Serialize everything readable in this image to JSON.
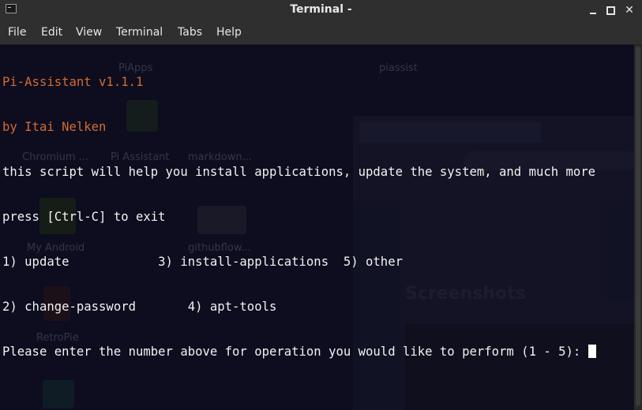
{
  "window": {
    "title": "Terminal -",
    "icon": "terminal-icon",
    "controls": [
      "minimize-icon",
      "maximize-icon",
      "close-icon"
    ],
    "close_glyph": "✕"
  },
  "menubar": {
    "items": [
      "File",
      "Edit",
      "View",
      "Terminal",
      "Tabs",
      "Help"
    ]
  },
  "terminal": {
    "lines": [
      "Pi-Assistant v1.1.1",
      "by Itai Nelken",
      "this script will help you install applications, update the system, and much more",
      "press [Ctrl-C] to exit",
      "1) update            3) install-applications  5) other",
      "2) change-password       4) apt-tools",
      "Please enter the number above for operation you would like to perform (1 - 5): "
    ],
    "colors": {
      "header": "#d46b30",
      "text": "#f2f2f2",
      "background": "#0d0d1f"
    }
  },
  "desktop_background": {
    "icon_labels": [
      "Chromium ...",
      "Pi Assistant",
      "markdown...",
      "My Android",
      "githubflow...",
      "RetroPie",
      "PiApps",
      "piassist"
    ],
    "browser_heading": "Screenshots"
  }
}
